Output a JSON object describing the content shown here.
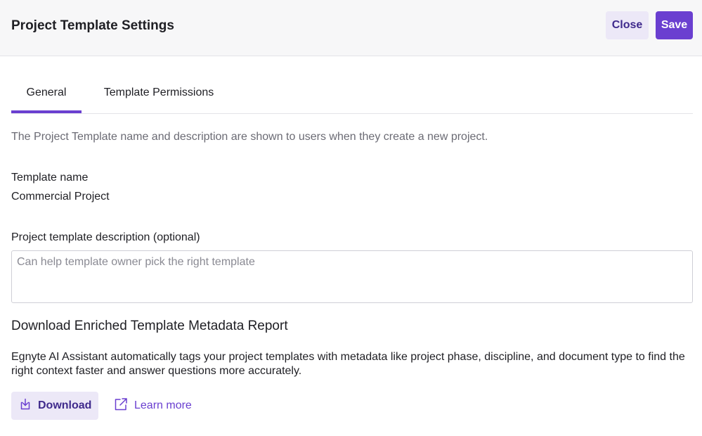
{
  "header": {
    "title": "Project Template Settings",
    "close_label": "Close",
    "save_label": "Save"
  },
  "tabs": [
    {
      "label": "General",
      "active": true
    },
    {
      "label": "Template Permissions",
      "active": false
    }
  ],
  "general": {
    "intro": "The Project Template name and description are shown to users when they create a new project.",
    "template_name_label": "Template name",
    "template_name_value": "Commercial Project",
    "description_label": "Project template description (optional)",
    "description_placeholder": "Can help template owner pick the right template",
    "description_value": ""
  },
  "metadata_report": {
    "title": "Download Enriched Template Metadata Report",
    "body": "Egnyte AI Assistant automatically tags your project templates with metadata like project phase, discipline, and document type to find the right context faster and answer questions more accurately.",
    "download_label": "Download",
    "download_icon": "download-icon",
    "learn_more_label": "Learn more",
    "learn_more_icon": "external-link-icon"
  },
  "colors": {
    "accent": "#6a3fd0",
    "accent_soft": "#ece8f7",
    "accent_text": "#3f2a8c",
    "header_bg": "#f7f7f8",
    "muted_text": "#6b6b74"
  }
}
